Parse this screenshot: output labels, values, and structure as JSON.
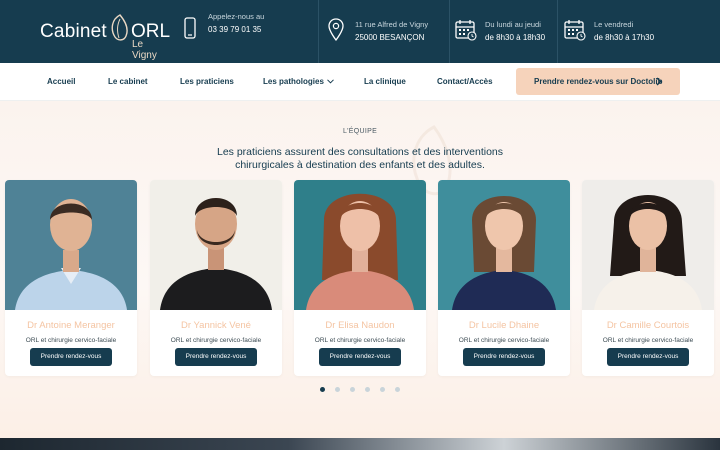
{
  "brand": {
    "name": "Cabinet",
    "name_accent": "ORL",
    "subtitle": "Le Vigny"
  },
  "contact": {
    "phone_label": "Appelez-nous au",
    "phone": "03 39 79 01 35",
    "address_line1": "11 rue Alfred de Vigny",
    "address_line2": "25000 BESANÇON",
    "hours1_label": "Du lundi au jeudi",
    "hours1_value": "de 8h30 à 18h30",
    "hours2_label": "Le vendredi",
    "hours2_value": "de 8h30 à 17h30"
  },
  "nav": {
    "items": [
      "Accueil",
      "Le cabinet",
      "Les praticiens",
      "Les pathologies",
      "La clinique",
      "Contact/Accès"
    ],
    "cta": "Prendre rendez-vous sur Doctolib"
  },
  "section": {
    "kicker": "L'ÉQUIPE",
    "headline": "Les praticiens assurent des consultations et des interventions chirurgicales à destination des enfants et des adultes."
  },
  "doctors": [
    {
      "name": "Dr Antoine Meranger",
      "specialty": "ORL et chirurgie cervico-faciale",
      "button": "Prendre rendez-vous"
    },
    {
      "name": "Dr Yannick Vené",
      "specialty": "ORL et chirurgie cervico-faciale",
      "button": "Prendre rendez-vous"
    },
    {
      "name": "Dr Elisa Naudon",
      "specialty": "ORL et chirurgie cervico-faciale",
      "button": "Prendre rendez-vous"
    },
    {
      "name": "Dr Lucile Dhaine",
      "specialty": "ORL et chirurgie cervico-faciale",
      "button": "Prendre rendez-vous"
    },
    {
      "name": "Dr Camille Courtois",
      "specialty": "ORL et chirurgie cervico-faciale",
      "button": "Prendre rendez-vous"
    }
  ],
  "carousel": {
    "page_count": 6,
    "active_page": 1
  },
  "colors": {
    "primary": "#163c4f",
    "accent": "#f6d3bb",
    "name_color": "#f4c4a2"
  },
  "icons": [
    "phone-icon",
    "location-pin-icon",
    "calendar-icon",
    "calendar-icon",
    "chevron-down-icon",
    "chevron-right-icon",
    "leaf-logo-icon"
  ]
}
